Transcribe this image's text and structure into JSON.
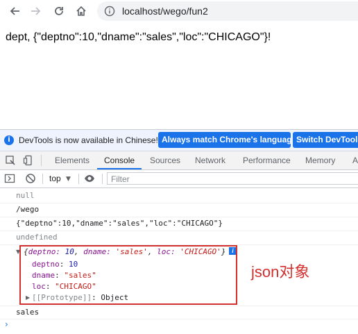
{
  "browser": {
    "url": "localhost/wego/fun2",
    "icons": [
      "back-arrow-icon",
      "forward-arrow-icon",
      "reload-icon",
      "home-icon",
      "site-info-icon"
    ]
  },
  "page": {
    "body_text": "dept, {\"deptno\":10,\"dname\":\"sales\",\"loc\":\"CHICAGO\"}!"
  },
  "devtools": {
    "infobar": {
      "message": "DevTools is now available in Chinese!",
      "match_button": "Always match Chrome's language",
      "switch_button": "Switch DevTools"
    },
    "tabs": [
      "Elements",
      "Console",
      "Sources",
      "Network",
      "Performance",
      "Memory",
      "A"
    ],
    "active_tab": "Console",
    "console_toolbar": {
      "context": "top",
      "filter_placeholder": "Filter"
    },
    "messages": {
      "m1": "null",
      "m2": "/wego",
      "m3": "{\"deptno\":10,\"dname\":\"sales\",\"loc\":\"CHICAGO\"}",
      "m4": "undefined",
      "obj": {
        "open": "{",
        "k1": "deptno: ",
        "v1": "10",
        "k2": "dname: ",
        "v2": "'sales'",
        "k3": "loc: ",
        "v3": "'CHICAGO'",
        "close": "}",
        "sep": ", "
      },
      "p1_key": "deptno",
      "p1_val": "10",
      "p2_key": "dname",
      "p2_val": "\"sales\"",
      "p3_key": "loc",
      "p3_val": "\"CHICAGO\"",
      "proto_key": "[[Prototype]]",
      "proto_val": "Object",
      "colon": ": ",
      "m6": "sales",
      "info_badge": "i"
    },
    "prompt_symbol": "›"
  },
  "annotation": {
    "text": "json对象",
    "color": "#d32f2f"
  },
  "colors": {
    "accent": "#1a73e8",
    "key": "#881391",
    "number": "#1a1aa6",
    "string": "#c41a16"
  }
}
